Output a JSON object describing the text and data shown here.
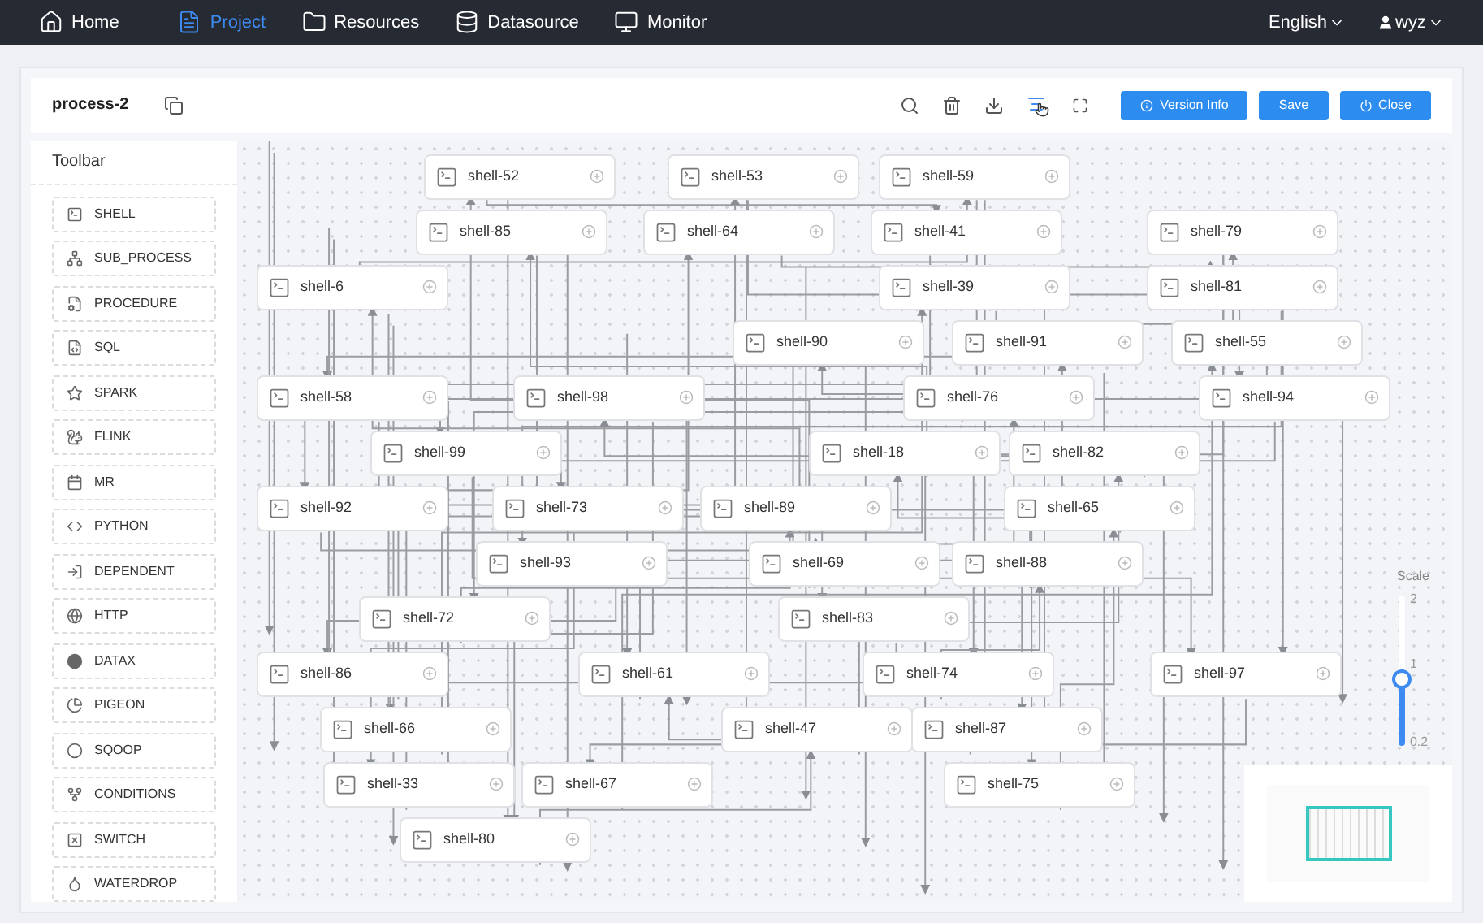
{
  "nav": {
    "items": [
      {
        "label": "Home",
        "selected": false
      },
      {
        "label": "Project",
        "selected": true
      },
      {
        "label": "Resources",
        "selected": false
      },
      {
        "label": "Datasource",
        "selected": false
      },
      {
        "label": "Monitor",
        "selected": false
      }
    ],
    "language": "English",
    "user": "wyz"
  },
  "header": {
    "title": "process-2",
    "buttons": [
      "Version Info",
      "Save",
      "Close"
    ]
  },
  "toolbar": {
    "title": "Toolbar",
    "items": [
      "SHELL",
      "SUB_PROCESS",
      "PROCEDURE",
      "SQL",
      "SPARK",
      "FLINK",
      "MR",
      "PYTHON",
      "DEPENDENT",
      "HTTP",
      "DATAX",
      "PIGEON",
      "SQOOP",
      "CONDITIONS",
      "SWITCH",
      "WATERDROP"
    ]
  },
  "canvas": {
    "nodes": [
      "shell-52",
      "shell-53",
      "shell-59",
      "shell-85",
      "shell-64",
      "shell-41",
      "shell-79",
      "shell-6",
      "shell-39",
      "shell-81",
      "shell-90",
      "shell-91",
      "shell-55",
      "shell-58",
      "shell-98",
      "shell-76",
      "shell-94",
      "shell-99",
      "shell-18",
      "shell-82",
      "shell-92",
      "shell-73",
      "shell-89",
      "shell-65",
      "shell-93",
      "shell-69",
      "shell-88",
      "shell-72",
      "shell-83",
      "shell-86",
      "shell-61",
      "shell-74",
      "shell-97",
      "shell-66",
      "shell-47",
      "shell-87",
      "shell-33",
      "shell-67",
      "shell-75",
      "shell-80"
    ]
  },
  "scale": {
    "label": "Scale",
    "max": "2",
    "value": "1",
    "min": "0.2",
    "level": 0.44
  }
}
